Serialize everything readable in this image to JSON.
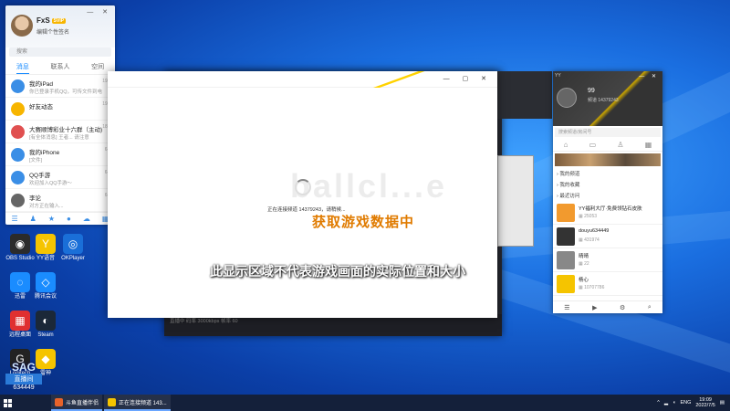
{
  "desktop": {
    "icons": [
      {
        "label": "OBS Studio",
        "color": "#2b2b2b",
        "glyph": "◉"
      },
      {
        "label": "YY语音",
        "color": "#f5c400",
        "glyph": "Y"
      },
      {
        "label": "OKPlayer",
        "color": "#1a6fd8",
        "glyph": "◎"
      },
      {
        "label": "迅雷",
        "color": "#1a8cff",
        "glyph": "◌"
      },
      {
        "label": "腾讯会议",
        "color": "#1a8cff",
        "glyph": "◇"
      },
      {
        "label": "远程桌面",
        "color": "#e03030",
        "glyph": "▦"
      },
      {
        "label": "Steam",
        "color": "#1b2838",
        "glyph": "◐"
      },
      {
        "label": "Logitech",
        "color": "#222",
        "glyph": "G"
      },
      {
        "label": "雷神",
        "color": "#f5c400",
        "glyph": "◆"
      }
    ],
    "logo_watermark": {
      "top": "SAG",
      "mid": "直播间",
      "id": "634449"
    }
  },
  "qq": {
    "name": "FxS",
    "vip": "SVIP",
    "signature": "编辑个性签名",
    "search_placeholder": "搜索",
    "tabs": [
      "消息",
      "联系人",
      "空间"
    ],
    "rows": [
      {
        "title": "我的iPad",
        "sub": "你已登录手机QQ，可传文件到电脑",
        "time": "19:0",
        "color": "#3a8ee6"
      },
      {
        "title": "好友动态",
        "sub": "",
        "time": "19:0",
        "color": "#f7b500"
      },
      {
        "title": "大赛顺博彩业十六群（主动)",
        "sub": "[有全体消息] 王者... 请注意",
        "time": "18:1",
        "color": "#e05050"
      },
      {
        "title": "我的iPhone",
        "sub": "[文件]",
        "time": "6-2",
        "color": "#3a8ee6"
      },
      {
        "title": "QQ手游",
        "sub": "欢迎加入QQ手游～",
        "time": "6-2",
        "color": "#3a8ee6"
      },
      {
        "title": "李论",
        "sub": "对方正在输入...",
        "time": "6-2",
        "color": "#666"
      }
    ]
  },
  "loading": {
    "connecting": "正在连接频道 14379243，请稍候...",
    "fetching": "获取游戏数据中",
    "watermark": "ballcl...e",
    "notice": "此显示区域不代表游戏画面的实际位置和大小"
  },
  "obs": {
    "status": "直播中  码率 3000kbps  帧率 60"
  },
  "room": {
    "title": "YY",
    "user": "99",
    "sub": "频道 14379243",
    "search": "搜索频道/房间号",
    "sections": [
      "我的频道",
      "我的收藏",
      "最近访问"
    ],
    "items": [
      {
        "name": "YY福利大厅·免费领钻石皮肤",
        "count": "25053",
        "color": "#f29a2e"
      },
      {
        "name": "douyu634449",
        "count": "431974",
        "color": "#333"
      },
      {
        "name": "晴晴",
        "count": "22",
        "color": "#888"
      },
      {
        "name": "杨心",
        "count": "10707786",
        "color": "#f5c400"
      }
    ]
  },
  "taskbar": {
    "apps": [
      {
        "label": "斗鱼直播伴侣",
        "color": "#e8632a"
      },
      {
        "label": "正在连接频道 143...",
        "color": "#f5c400"
      }
    ],
    "lang": "ENG",
    "time": "19:09",
    "date": "2022/7/5"
  }
}
